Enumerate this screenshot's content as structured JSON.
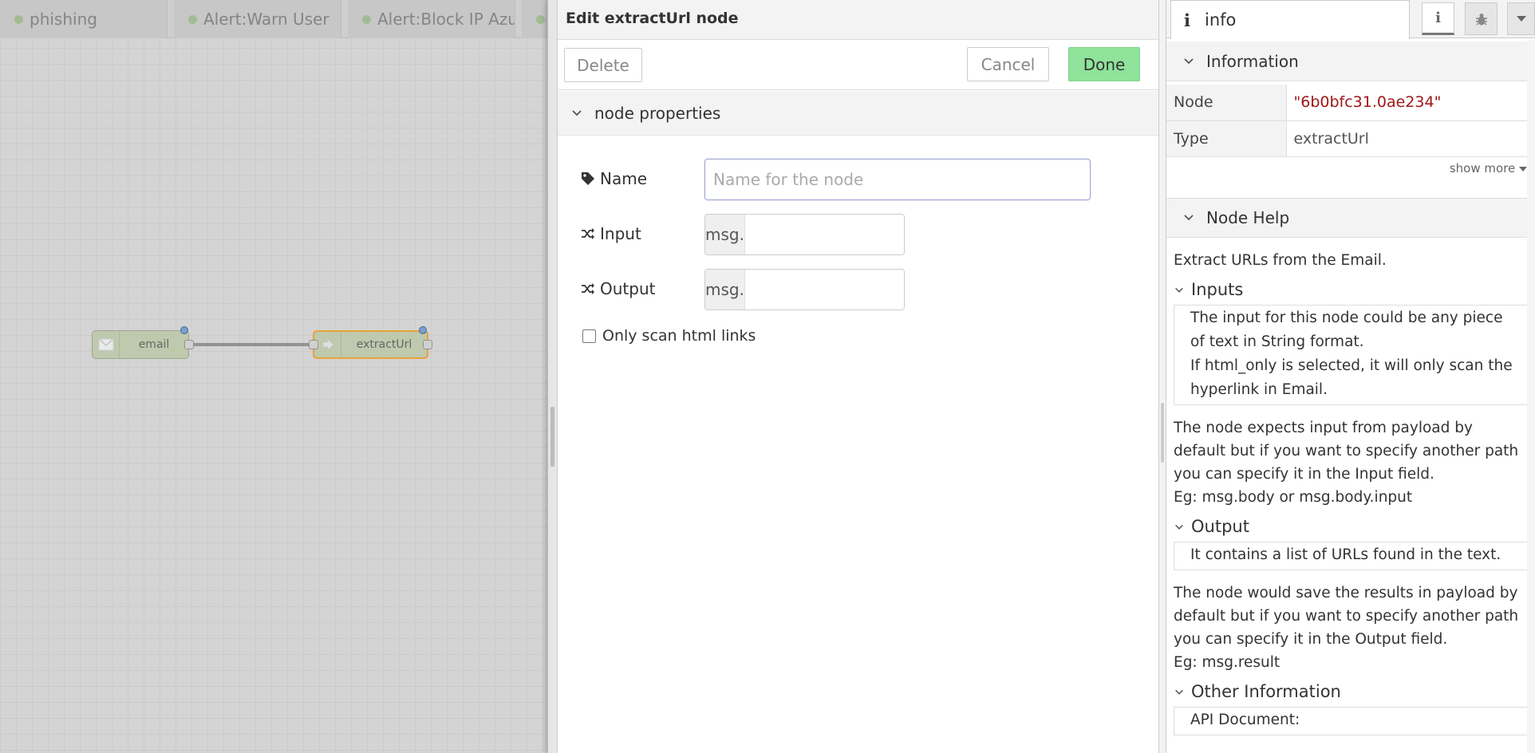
{
  "workspace": {
    "tabs": [
      {
        "label": "phishing"
      },
      {
        "label": "Alert:Warn User"
      },
      {
        "label": "Alert:Block IP Azure"
      }
    ],
    "nodes": {
      "email": {
        "label": "email",
        "icon": "envelope-icon"
      },
      "extract": {
        "label": "extractUrl",
        "icon": "arrow-right-icon"
      }
    }
  },
  "tray": {
    "title": "Edit extractUrl node",
    "delete_label": "Delete",
    "cancel_label": "Cancel",
    "done_label": "Done",
    "section_label": "node properties",
    "fields": {
      "name_label": "Name",
      "name_placeholder": "Name for the node",
      "name_value": "",
      "input_label": "Input",
      "input_prefix": "msg.",
      "input_value": "",
      "output_label": "Output",
      "output_prefix": "msg.",
      "output_value": "",
      "html_only_label": "Only scan html links",
      "html_only_checked": false
    }
  },
  "sidebar": {
    "tab_label": "info",
    "info_section": "Information",
    "info_rows": [
      {
        "key": "Node",
        "value": "\"6b0bfc31.0ae234\""
      },
      {
        "key": "Type",
        "value": "extractUrl"
      }
    ],
    "show_more": "show more",
    "help_section": "Node Help",
    "help_intro": "Extract URLs from the Email.",
    "inputs_title": "Inputs",
    "inputs_lines": [
      "The input for this node could be any piece of text in String format.",
      "If html_only is selected, it will only scan the hyperlink in Email."
    ],
    "inputs_note": "The node expects input from payload by default but if you want to specify another path you can specify it in the Input field.",
    "inputs_example": "Eg: msg.body or msg.body.input",
    "output_title": "Output",
    "output_line": "It contains a list of URLs found in the text.",
    "output_note": "The node would save the results in payload by default but if you want to specify another path you can specify it in the Output field.",
    "output_example": "Eg: msg.result",
    "other_title": "Other Information",
    "other_line": "API Document:"
  },
  "colors": {
    "done_button": "#8fe39a",
    "node_fill": "#c7d2b5",
    "selected_border": "#f3a93b",
    "node_id": "#a01717"
  }
}
